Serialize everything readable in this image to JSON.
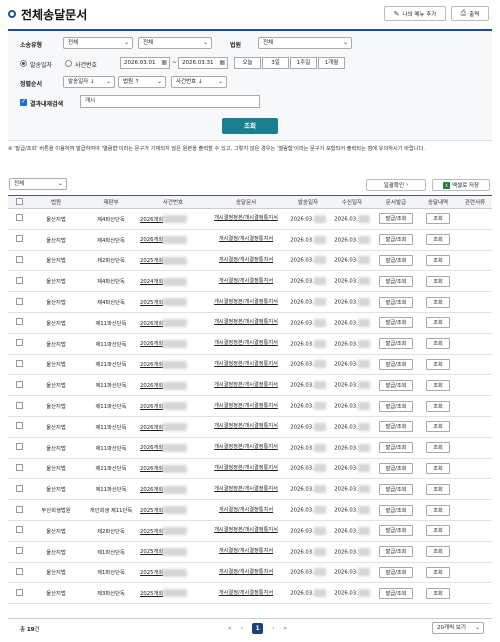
{
  "header": {
    "title": "전체송달문서",
    "add_menu_label": "나의 메뉴 추가",
    "print_label": "출력"
  },
  "search": {
    "case_type_label": "소송유형",
    "case_type_value1": "전체",
    "case_type_value2": "전체",
    "court_label": "법원",
    "court_value": "전체",
    "radio_receive_label": "발송일자",
    "radio_case_label": "사건번호",
    "date_from": "2026.03.01",
    "date_to": "2026.03.31",
    "tilde": "~",
    "period_buttons": [
      "오늘",
      "3일",
      "1주일",
      "1개월"
    ],
    "sort_label": "정렬순서",
    "sort1": "발송일자 ↓",
    "sort2": "법원 ↑",
    "sort3": "사건번호 ↓",
    "refine_label": "결과내재검색",
    "refine_value": "개시",
    "submit_label": "조회"
  },
  "notice": "※ '발급/조회' 버튼을 이용하여 발급하여야 '열람함'이라는 문구가 기재되지 않은 원본을 출력할 수 있고, 그렇지 않은 경우는 '열람함'이라는 문구가 포함되어 출력되는 점에 유의하시기 바랍니다.",
  "filter_value": "전체",
  "bulk_confirm_label": "일괄확인",
  "excel_label": "엑셀로 저장",
  "columns": [
    "",
    "법원",
    "재판부",
    "사건번호",
    "송달문서",
    "발송일자",
    "수신일자",
    "문서발급",
    "송달내역",
    "관련서류"
  ],
  "rows": [
    {
      "court": "울산지법",
      "dept": "제4파산단독",
      "case": "2026개회",
      "doc": "개시결정정본/개시결정통지서",
      "sent": "2026.03.",
      "recv": "2026.03.",
      "issue": "발급/조회",
      "history": "조회"
    },
    {
      "court": "울산지법",
      "dept": "제4파산단독",
      "case": "2026개회",
      "doc": "개시결정/개시결정통지서",
      "sent": "2026.03.",
      "recv": "2026.03.",
      "issue": "발급/조회",
      "history": "조회"
    },
    {
      "court": "울산지법",
      "dept": "제2파산단독",
      "case": "2025개회",
      "doc": "개시결정/개시결정통지서",
      "sent": "2026.03.",
      "recv": "2026.03.",
      "issue": "발급/조회",
      "history": "조회"
    },
    {
      "court": "울산지법",
      "dept": "제4파산단독",
      "case": "2024개회",
      "doc": "개시결정/개시결정통지서",
      "sent": "2026.03.",
      "recv": "2026.03.",
      "issue": "발급/조회",
      "history": "조회"
    },
    {
      "court": "울산지법",
      "dept": "제4파산단독",
      "case": "2025개회",
      "doc": "개시결정정본/개시결정통지서",
      "sent": "2026.03.",
      "recv": "2026.03.",
      "issue": "발급/조회",
      "history": "조회"
    },
    {
      "court": "울산지법",
      "dept": "제11파산단독",
      "case": "2026개회",
      "doc": "개시결정정본/개시결정통지서",
      "sent": "2026.03.",
      "recv": "2026.03.",
      "issue": "발급/조회",
      "history": "조회"
    },
    {
      "court": "울산지법",
      "dept": "제11파산단독",
      "case": "2026개회",
      "doc": "개시결정정본/개시결정통지서",
      "sent": "2026.03.",
      "recv": "2026.03.",
      "issue": "발급/조회",
      "history": "조회"
    },
    {
      "court": "울산지법",
      "dept": "제11파산단독",
      "case": "2026개회",
      "doc": "개시결정정본/개시결정통지서",
      "sent": "2026.03.",
      "recv": "2026.03.",
      "issue": "발급/조회",
      "history": "조회"
    },
    {
      "court": "울산지법",
      "dept": "제11파산단독",
      "case": "2026개회",
      "doc": "개시결정정본/개시결정통지서",
      "sent": "2026.03.",
      "recv": "2026.03.",
      "issue": "발급/조회",
      "history": "조회"
    },
    {
      "court": "울산지법",
      "dept": "제11파산단독",
      "case": "2026개회",
      "doc": "개시결정정본/개시결정통지서",
      "sent": "2026.03.",
      "recv": "2026.03.",
      "issue": "발급/조회",
      "history": "조회"
    },
    {
      "court": "울산지법",
      "dept": "제11파산단독",
      "case": "2026개회",
      "doc": "개시결정정본/개시결정통지서",
      "sent": "2026.03.",
      "recv": "2026.03.",
      "issue": "발급/조회",
      "history": "조회"
    },
    {
      "court": "울산지법",
      "dept": "제11파산단독",
      "case": "2026개회",
      "doc": "개시결정정본/개시결정통지서",
      "sent": "2026.03.",
      "recv": "2026.03.",
      "issue": "발급/조회",
      "history": "조회"
    },
    {
      "court": "울산지법",
      "dept": "제11파산단독",
      "case": "2026개회",
      "doc": "개시결정정본/개시결정통지서",
      "sent": "2026.03.",
      "recv": "2026.03.",
      "issue": "발급/조회",
      "history": "조회"
    },
    {
      "court": "울산지법",
      "dept": "제11파산단독",
      "case": "2026개회",
      "doc": "개시결정정본/개시결정통지서",
      "sent": "2026.03.",
      "recv": "2026.03.",
      "issue": "발급/조회",
      "history": "조회"
    },
    {
      "court": "부산회생법원",
      "dept": "개인회생 제11단독",
      "case": "2025개회",
      "doc": "개시결정/개시결정통지서",
      "sent": "2026.03.",
      "recv": "2026.03.",
      "issue": "발급/조회",
      "history": "조회"
    },
    {
      "court": "울산지법",
      "dept": "제2파산단독",
      "case": "2025개회",
      "doc": "개시결정정본/개시결정통지서",
      "sent": "2026.03.",
      "recv": "2026.03.",
      "issue": "발급/조회",
      "history": "조회"
    },
    {
      "court": "울산지법",
      "dept": "제1파산단독",
      "case": "2025개회",
      "doc": "개시결정/개시결정통지서",
      "sent": "2026.03.",
      "recv": "2026.03.",
      "issue": "발급/조회",
      "history": "조회"
    },
    {
      "court": "울산지법",
      "dept": "제1파산단독",
      "case": "2025개회",
      "doc": "개시결정/개시결정통지서",
      "sent": "2026.03.",
      "recv": "2026.03.",
      "issue": "발급/조회",
      "history": "조회"
    },
    {
      "court": "울산지법",
      "dept": "제3파산단독",
      "case": "2025개회",
      "doc": "개시결정/개시결정통지서",
      "sent": "2026.03.",
      "recv": "2026.03.",
      "issue": "발급/조회",
      "history": "조회"
    }
  ],
  "footer": {
    "total_prefix": "총",
    "total_count": "19",
    "total_suffix": "건",
    "first": "«",
    "prev": "‹",
    "page": "1",
    "next": "›",
    "last": "»",
    "per_page": "20개씩 보기"
  }
}
